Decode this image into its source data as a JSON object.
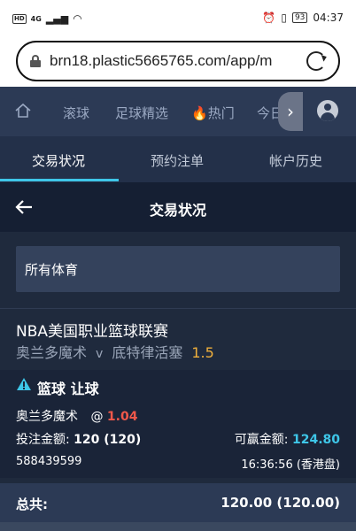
{
  "status_bar": {
    "time": "04:37",
    "battery": "93",
    "network": "4G",
    "hd": "HD"
  },
  "browser": {
    "url": "brn18.plastic5665765.com/app/m"
  },
  "nav": {
    "items": [
      "滚球",
      "足球精选",
      "热门",
      "今日"
    ],
    "hot_icon": "fire-icon"
  },
  "tabs": [
    {
      "label": "交易状况",
      "active": true
    },
    {
      "label": "预约注单",
      "active": false
    },
    {
      "label": "帐户历史",
      "active": false
    }
  ],
  "header": {
    "title": "交易状况"
  },
  "filter": {
    "value": "所有体育"
  },
  "bet": {
    "league": "NBA美国职业篮球联赛",
    "home": "奥兰多魔术",
    "vs": "v",
    "away": "底特律活塞",
    "line": "1.5",
    "type": "篮球 让球",
    "selection": "奥兰多魔术",
    "at": "@",
    "odds": "1.04",
    "stake_label": "投注金额:",
    "stake_value": "120 (120)",
    "win_label": "可赢金额:",
    "win_value": "124.80",
    "ticket_id": "588439599",
    "time": "16:36:56 (香港盘)"
  },
  "total": {
    "label": "总共:",
    "value": "120.00 (120.00)"
  },
  "colors": {
    "accent": "#3ec6e8",
    "odds": "#f0584a",
    "line": "#f0b03c"
  }
}
